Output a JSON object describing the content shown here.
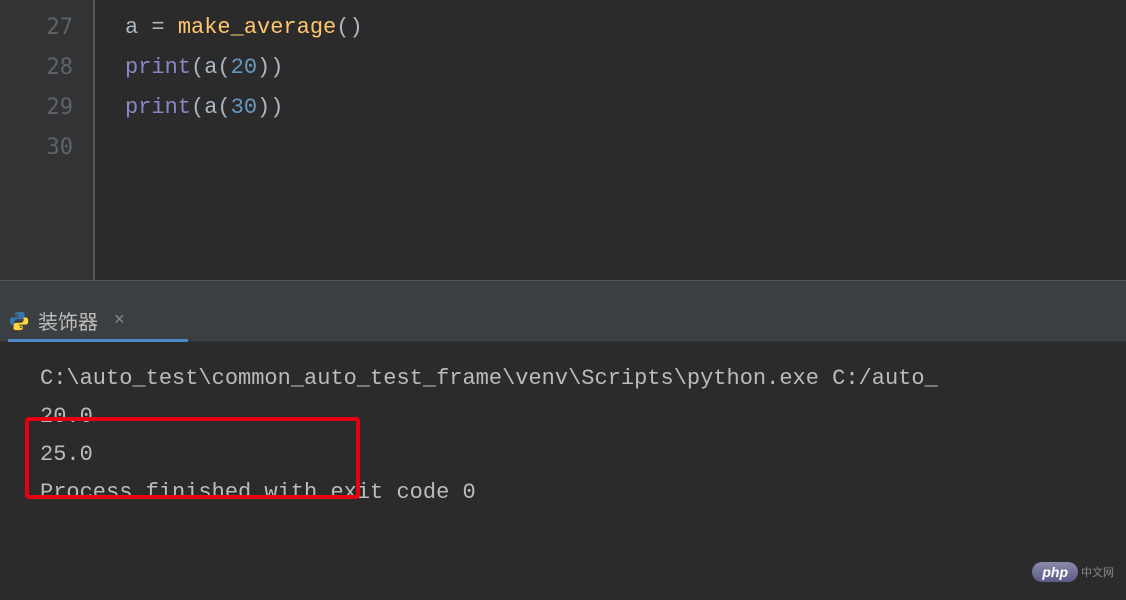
{
  "editor": {
    "lines": [
      {
        "num": "27",
        "tokens": [
          {
            "t": "a",
            "c": "code-var"
          },
          {
            "t": " ",
            "c": ""
          },
          {
            "t": "=",
            "c": "code-op"
          },
          {
            "t": " ",
            "c": ""
          },
          {
            "t": "make_average",
            "c": "code-func"
          },
          {
            "t": "()",
            "c": "code-paren"
          }
        ]
      },
      {
        "num": "28",
        "tokens": [
          {
            "t": "print",
            "c": "code-builtin"
          },
          {
            "t": "(",
            "c": "code-paren"
          },
          {
            "t": "a",
            "c": "code-var"
          },
          {
            "t": "(",
            "c": "code-paren"
          },
          {
            "t": "20",
            "c": "code-num"
          },
          {
            "t": "))",
            "c": "code-paren"
          }
        ]
      },
      {
        "num": "29",
        "tokens": [
          {
            "t": "print",
            "c": "code-builtin"
          },
          {
            "t": "(",
            "c": "code-paren"
          },
          {
            "t": "a",
            "c": "code-var"
          },
          {
            "t": "(",
            "c": "code-paren"
          },
          {
            "t": "30",
            "c": "code-num"
          },
          {
            "t": "))",
            "c": "code-paren"
          }
        ]
      },
      {
        "num": "30",
        "tokens": []
      }
    ]
  },
  "run_tab": {
    "label": "装饰器",
    "close": "×"
  },
  "console": {
    "lines": [
      "C:\\auto_test\\common_auto_test_frame\\venv\\Scripts\\python.exe C:/auto_",
      "20.0",
      "25.0",
      "",
      "Process finished with exit code 0"
    ]
  },
  "watermark": {
    "badge": "php",
    "text": "中文网"
  }
}
